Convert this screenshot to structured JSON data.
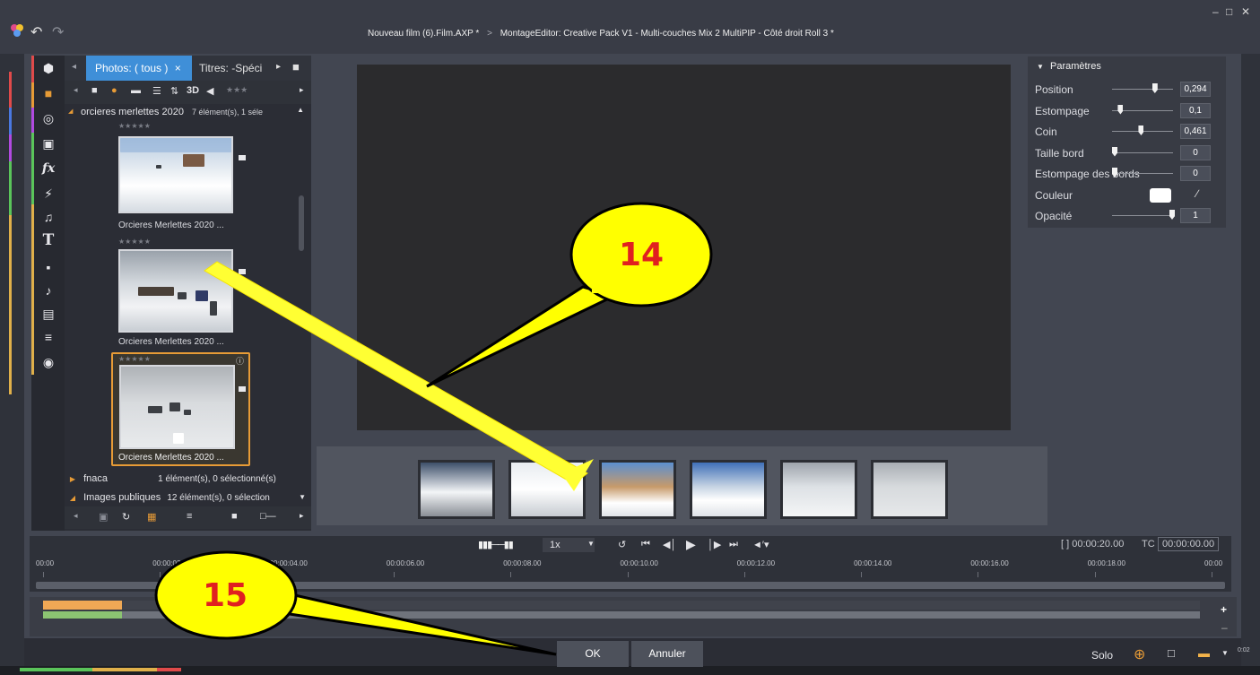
{
  "window": {
    "title_project": "Nouveau film (6).Film.AXP *",
    "title_separator": ">",
    "title_editor": "MontageEditor: Creative Pack V1 - Multi-couches Mix 2  MultiPIP - Côté droit Roll 3 *"
  },
  "library": {
    "tab_active": "Photos: ( tous )",
    "tab_close": "×",
    "tab_second": "Titres: -Spéci",
    "view_mode": "3D",
    "group_open": {
      "name": "orcieres merlettes 2020",
      "info": "7 élément(s), 1 séle"
    },
    "items": [
      {
        "caption": "Orcieres Merlettes 2020 ...",
        "stars": "★★★★★"
      },
      {
        "caption": "Orcieres Merlettes 2020 ...",
        "stars": "★★★★★"
      },
      {
        "caption": "Orcieres Merlettes 2020 ...",
        "stars": "★★★★★",
        "selected": true
      }
    ],
    "groups_closed": [
      {
        "name": "fnaca",
        "info": "1 élément(s), 0 sélectionné(s)"
      },
      {
        "name": "Images publiques",
        "info": "12 élément(s), 0 sélection"
      }
    ]
  },
  "parameters": {
    "header": "Paramètres",
    "rows": [
      {
        "label": "Position",
        "value": "0,294",
        "knob": 0.7
      },
      {
        "label": "Estompage",
        "value": "0,1",
        "knob": 0.1
      },
      {
        "label": "Coin",
        "value": "0,461",
        "knob": 0.46
      },
      {
        "label": "Taille bord",
        "value": "0",
        "knob": 0.0
      },
      {
        "label": "Estompage des bords",
        "value": "0",
        "knob": 0.0
      },
      {
        "label": "Couleur",
        "value": "",
        "knob": null
      },
      {
        "label": "Opacité",
        "value": "1",
        "knob": 1.0
      }
    ],
    "color_value": "#ffffff"
  },
  "transport": {
    "speed": "1x",
    "duration": "[ ] 00:00:20.00",
    "tc_label": "TC",
    "timecode": "00:00:00.00",
    "ruler": [
      "00:00",
      "00:00:02.00",
      "00:00:04.00",
      "00:00:06.00",
      "00:00:08.00",
      "00:00:10.00",
      "00:00:12.00",
      "00:00:14.00",
      "00:00:16.00",
      "00:00:18.00",
      "00:00"
    ]
  },
  "dialog": {
    "ok": "OK",
    "cancel": "Annuler",
    "solo": "Solo",
    "corner_time": "0:02"
  },
  "callouts": [
    {
      "label": "14"
    },
    {
      "label": "15"
    }
  ],
  "colors": {
    "accent_blue": "#3f8fd8",
    "selection_orange": "#e79b36",
    "callout_fill": "#ffff00",
    "callout_text": "#e02020"
  }
}
